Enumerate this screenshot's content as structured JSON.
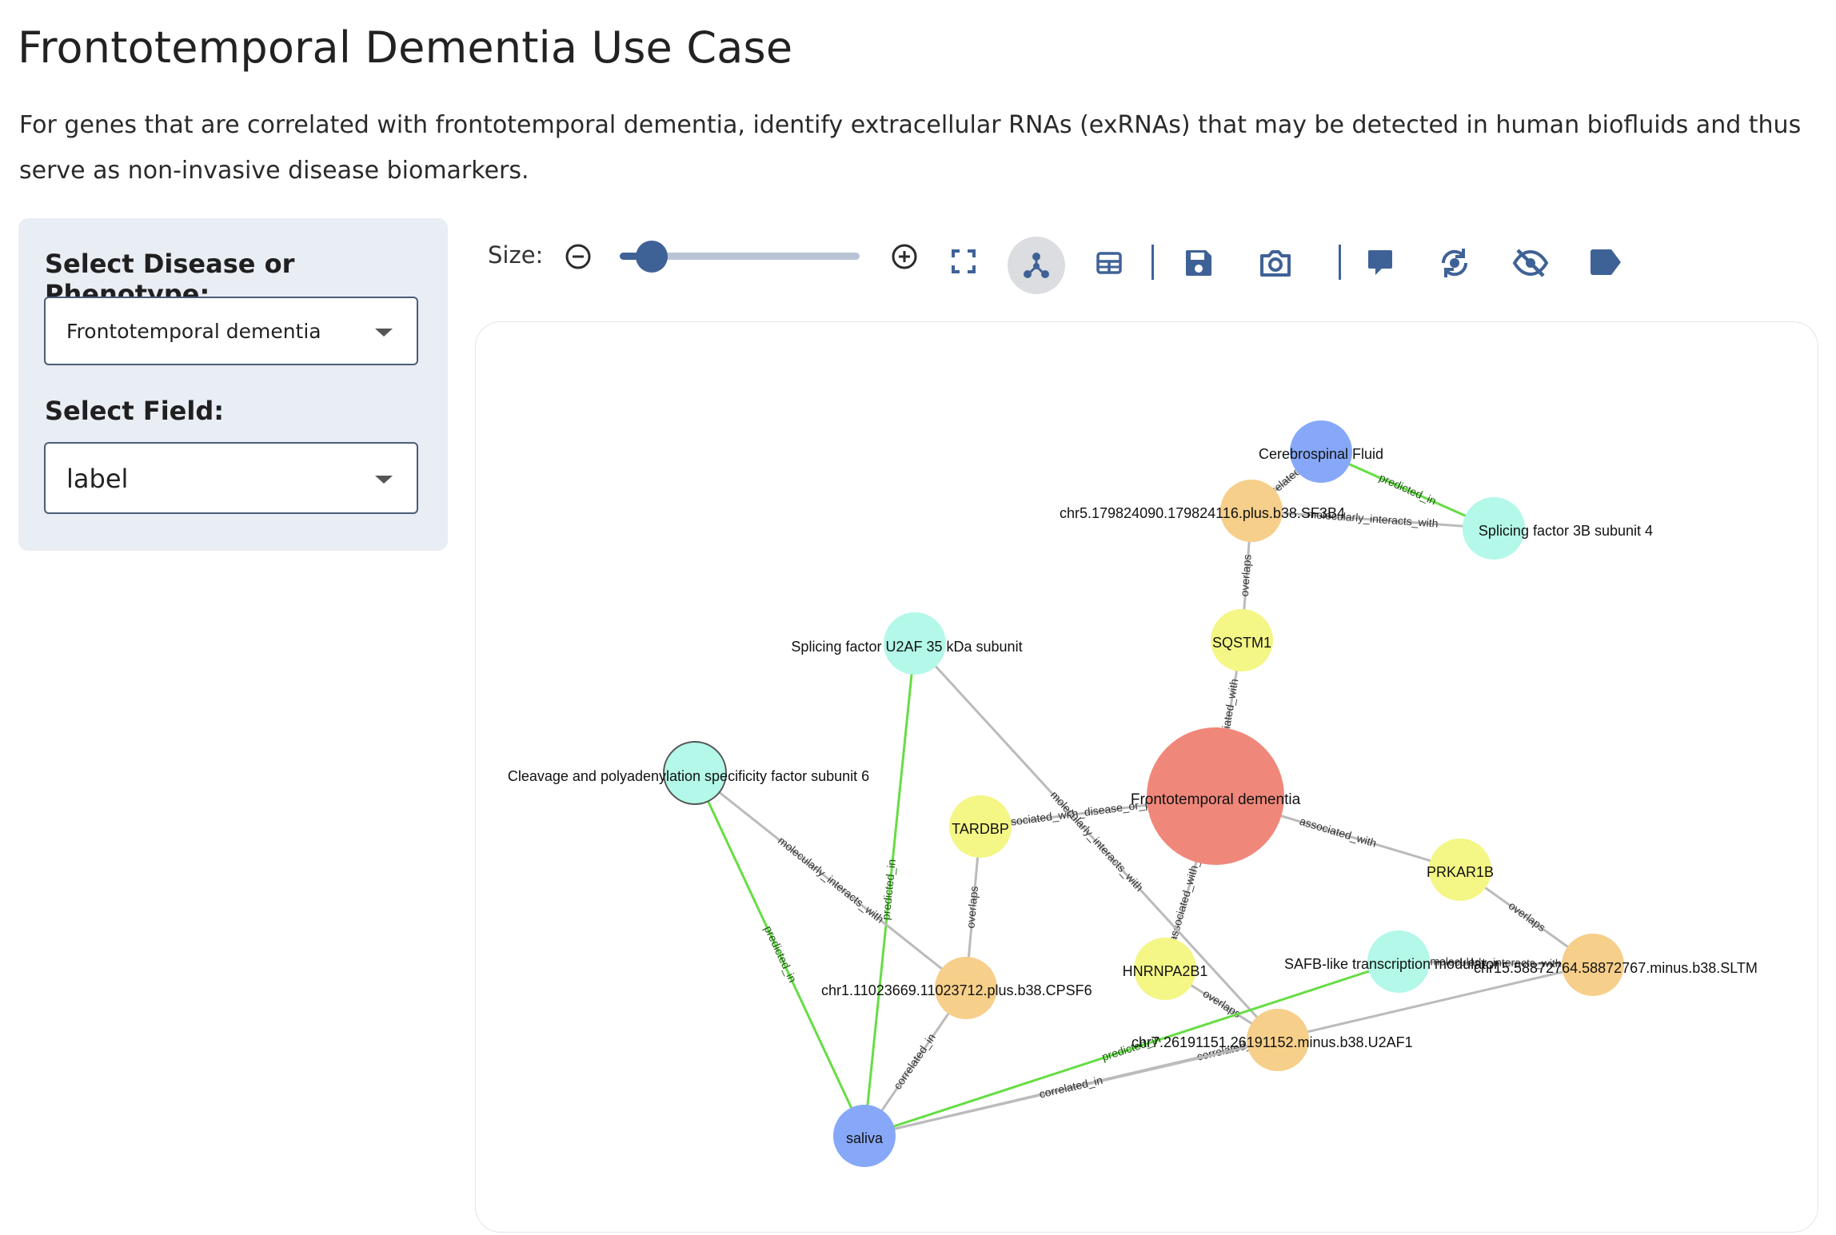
{
  "page": {
    "title": "Frontotemporal Dementia Use Case",
    "description": "For genes that are correlated with frontotemporal dementia, identify extracellular RNAs (exRNAs) that may be detected in human biofluids and thus serve as non-invasive disease biomarkers."
  },
  "sidebar": {
    "disease_label": "Select Disease or Phenotype:",
    "disease_value": "Frontotemporal dementia",
    "field_label": "Select Field:",
    "field_value": "label"
  },
  "toolbar": {
    "size_label": "Size:",
    "size_level_percent": 10,
    "icons": [
      "zoom-out-icon",
      "zoom-in-icon",
      "fullscreen-icon",
      "network-view-icon",
      "table-view-icon",
      "save-icon",
      "camera-icon",
      "comment-icon",
      "refresh-layout-icon",
      "hide-icon",
      "tag-icon"
    ],
    "accent_color": "#3f6296"
  },
  "graph": {
    "colors": {
      "disease": "#f0877b",
      "gene": "#f4f686",
      "exrna": "#f6cf8a",
      "protein": "#b3f8e8",
      "biofluid": "#87a8f8",
      "edge_default": "#bbbbbb",
      "edge_predicted": "#66dd44"
    },
    "nodes": [
      {
        "id": "csf",
        "label": "Cerebrospinal Fluid",
        "type": "biofluid"
      },
      {
        "id": "sf3b4_rna",
        "label": "chr5.179824090.179824116.plus.b38.SF3B4",
        "type": "exrna"
      },
      {
        "id": "sf3b4",
        "label": "Splicing factor 3B subunit 4",
        "type": "protein"
      },
      {
        "id": "sqstm1",
        "label": "SQSTM1",
        "type": "gene"
      },
      {
        "id": "u2af",
        "label": "Splicing factor U2AF 35 kDa subunit",
        "type": "protein"
      },
      {
        "id": "cpsf6",
        "label": "Cleavage and polyadenylation specificity factor subunit 6",
        "type": "protein"
      },
      {
        "id": "ftd",
        "label": "Frontotemporal dementia",
        "type": "disease"
      },
      {
        "id": "tardbp",
        "label": "TARDBP",
        "type": "gene"
      },
      {
        "id": "prkar1b",
        "label": "PRKAR1B",
        "type": "gene"
      },
      {
        "id": "cpsf6_rna",
        "label": "chr1.11023669.11023712.plus.b38.CPSF6",
        "type": "exrna"
      },
      {
        "id": "hnrnpa2b1",
        "label": "HNRNPA2B1",
        "type": "gene"
      },
      {
        "id": "safb",
        "label": "SAFB-like transcription modulator",
        "type": "protein"
      },
      {
        "id": "sltm_rna",
        "label": "chr15.58872764.58872767.minus.b38.SLTM",
        "type": "exrna"
      },
      {
        "id": "u2af1_rna",
        "label": "chr7.26191151.26191152.minus.b38.U2AF1",
        "type": "exrna"
      },
      {
        "id": "saliva",
        "label": "saliva",
        "type": "biofluid"
      }
    ],
    "edges": [
      {
        "from": "csf",
        "to": "sf3b4",
        "label": "predicted_in",
        "kind": "predicted"
      },
      {
        "from": "csf",
        "to": "sf3b4_rna",
        "label": "correlated_in",
        "kind": "default"
      },
      {
        "from": "sf3b4_rna",
        "to": "sf3b4",
        "label": "molecularly_interacts_with",
        "kind": "default"
      },
      {
        "from": "sf3b4_rna",
        "to": "sqstm1",
        "label": "overlaps",
        "kind": "default"
      },
      {
        "from": "sqstm1",
        "to": "ftd",
        "label": "associated_with",
        "kind": "default"
      },
      {
        "from": "tardbp",
        "to": "ftd",
        "label": "associated_with_disease_or_phenotype",
        "kind": "default"
      },
      {
        "from": "ftd",
        "to": "prkar1b",
        "label": "associated_with",
        "kind": "default"
      },
      {
        "from": "ftd",
        "to": "hnrnpa2b1",
        "label": "associated_with_disease",
        "kind": "default"
      },
      {
        "from": "u2af",
        "to": "saliva",
        "label": "predicted_in",
        "kind": "predicted"
      },
      {
        "from": "u2af",
        "to": "u2af1_rna",
        "label": "molecularly_interacts_with",
        "kind": "default"
      },
      {
        "from": "cpsf6",
        "to": "saliva",
        "label": "predicted_in",
        "kind": "predicted"
      },
      {
        "from": "cpsf6",
        "to": "cpsf6_rna",
        "label": "molecularly_interacts_with",
        "kind": "default"
      },
      {
        "from": "tardbp",
        "to": "cpsf6_rna",
        "label": "overlaps",
        "kind": "default"
      },
      {
        "from": "cpsf6_rna",
        "to": "saliva",
        "label": "correlated_in",
        "kind": "default"
      },
      {
        "from": "prkar1b",
        "to": "sltm_rna",
        "label": "overlaps",
        "kind": "default"
      },
      {
        "from": "safb",
        "to": "sltm_rna",
        "label": "molecularly_interacts_with",
        "kind": "default"
      },
      {
        "from": "hnrnpa2b1",
        "to": "u2af1_rna",
        "label": "overlaps",
        "kind": "default"
      },
      {
        "from": "safb",
        "to": "saliva",
        "label": "predicted_in",
        "kind": "predicted"
      },
      {
        "from": "sltm_rna",
        "to": "saliva",
        "label": "correlated_in",
        "kind": "default"
      },
      {
        "from": "u2af1_rna",
        "to": "saliva",
        "label": "correlated_in",
        "kind": "default"
      }
    ]
  }
}
